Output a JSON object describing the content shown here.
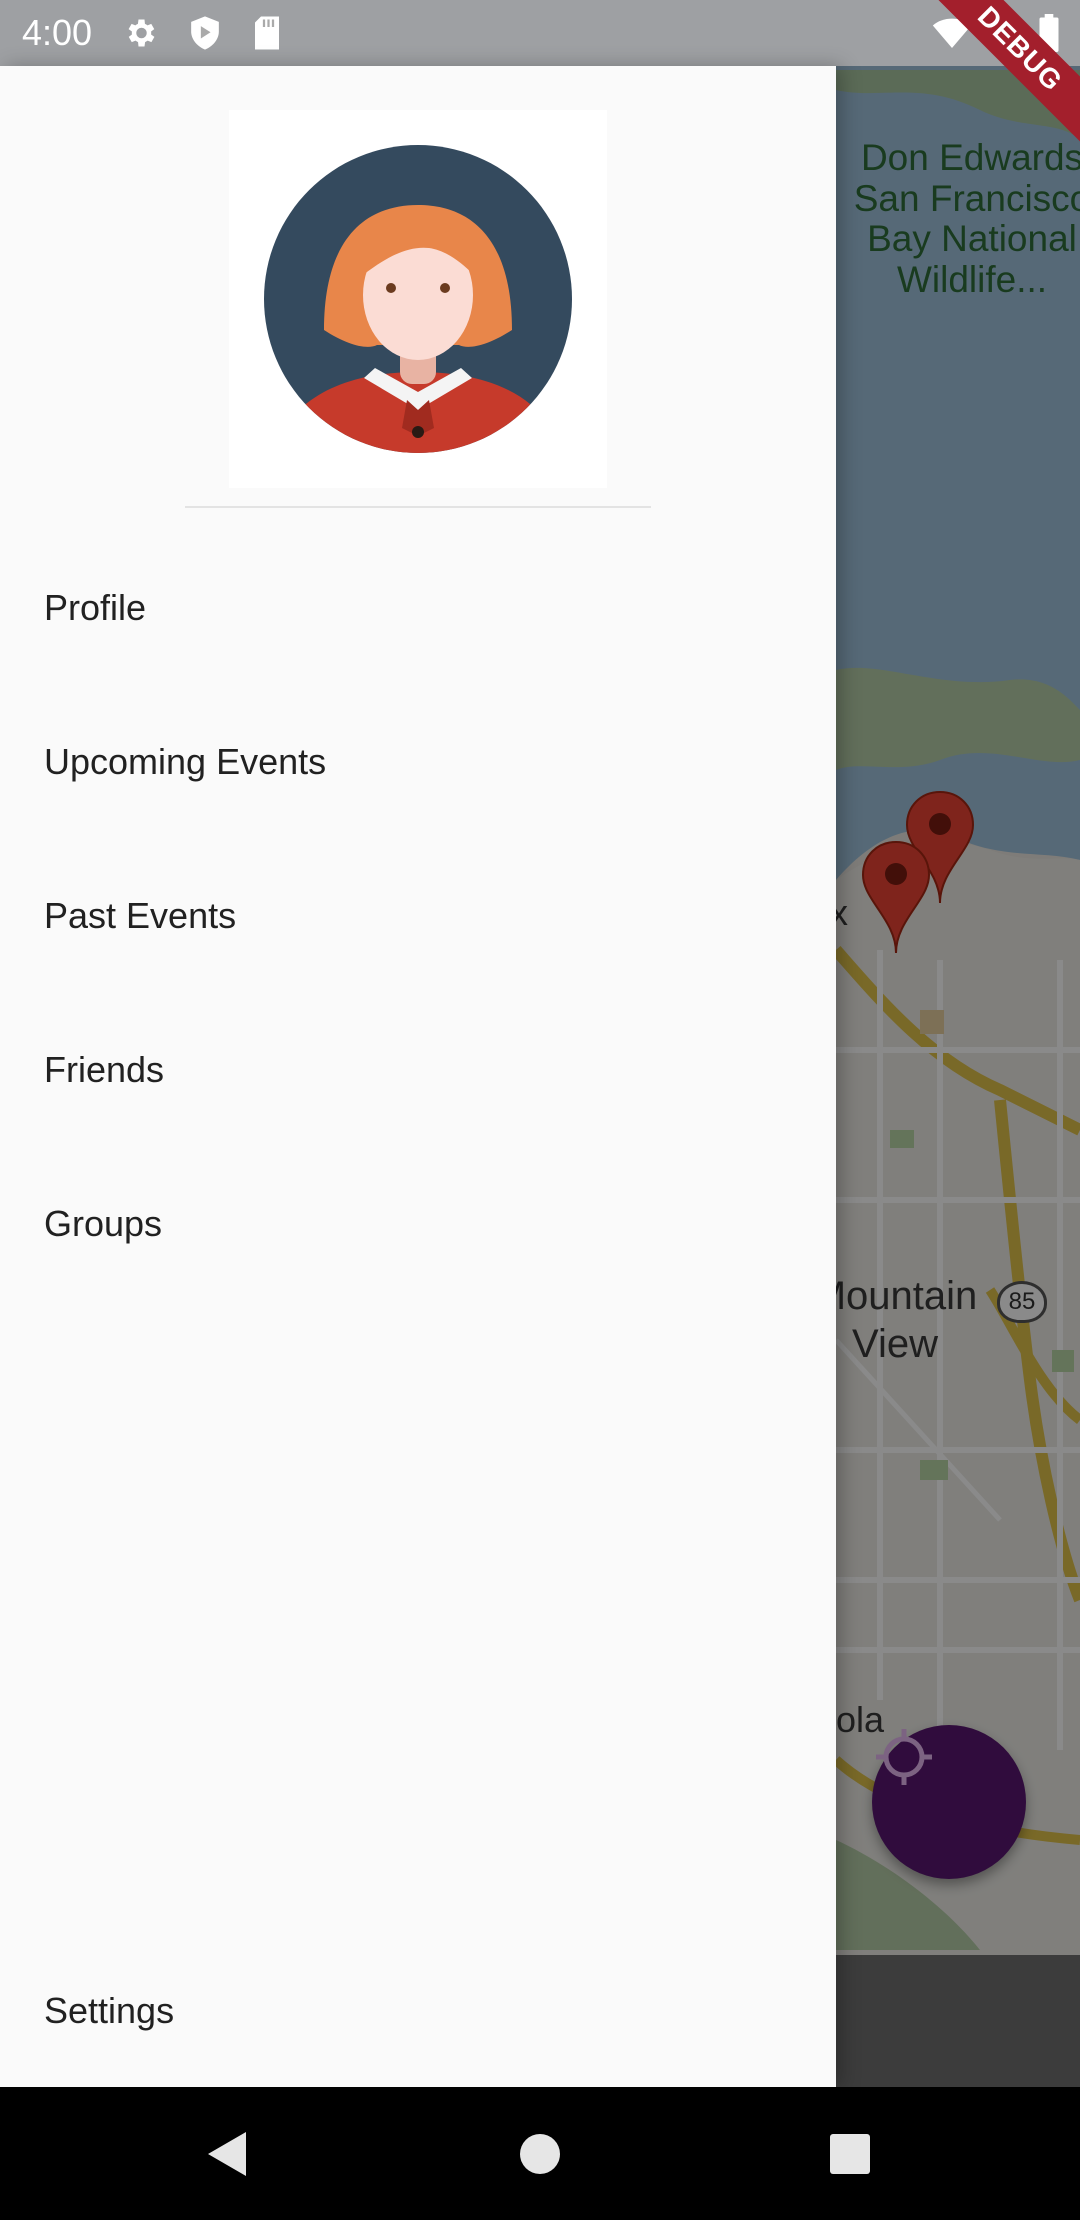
{
  "status_bar": {
    "time": "4:00",
    "icons": [
      "settings-gear-icon",
      "shield-icon",
      "sd-card-icon",
      "wifi-icon",
      "cell-signal-icon",
      "battery-icon"
    ]
  },
  "debug_banner": "DEBUG",
  "map": {
    "labels": {
      "park": "Don Edwards San Francisco Bay National Wildlife...",
      "city": "Mountain View",
      "fragment_x": "x",
      "fragment_ola": "ola",
      "highway": "85"
    },
    "marker_color": "#8e1a1a"
  },
  "drawer": {
    "menu_items": [
      "Profile",
      "Upcoming Events",
      "Past Events",
      "Friends",
      "Groups"
    ],
    "settings_label": "Settings"
  },
  "fab": {
    "icon": "my-location-icon",
    "color": "#5a1772"
  },
  "nav_bar": {
    "buttons": [
      "back-icon",
      "home-icon",
      "recents-icon"
    ]
  }
}
